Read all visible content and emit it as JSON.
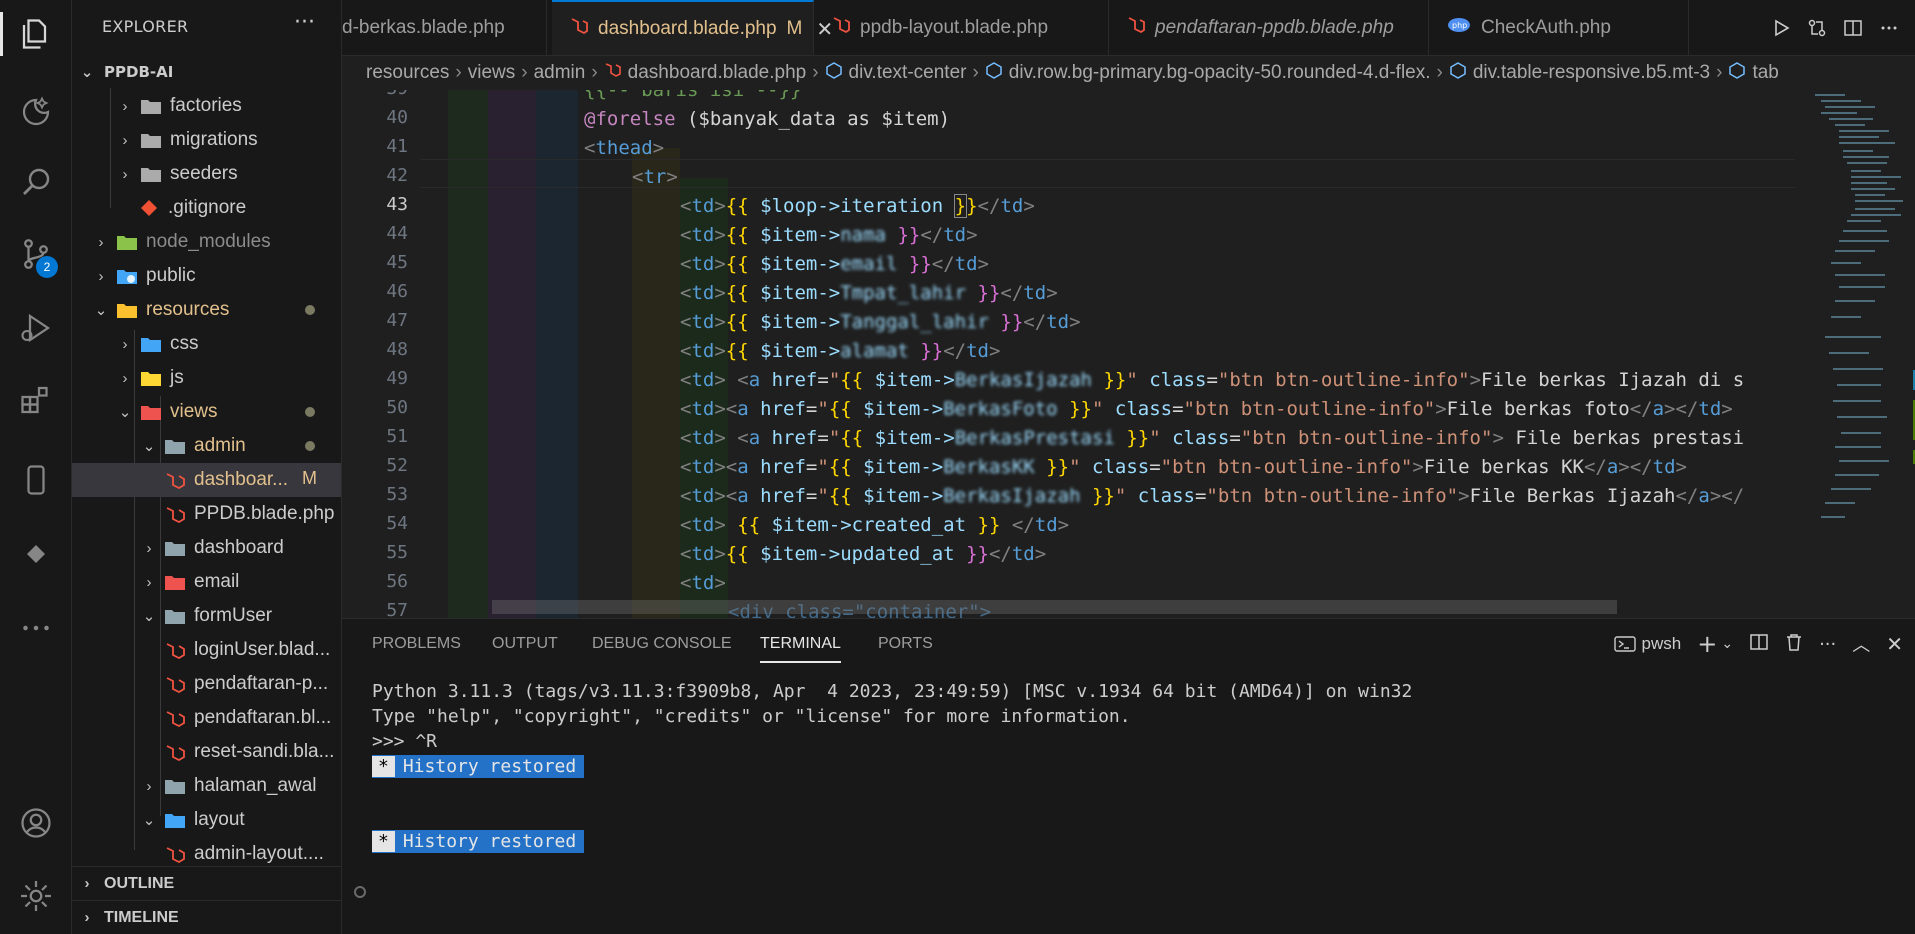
{
  "activity_bar": {
    "source_control_badge": "2"
  },
  "sidebar": {
    "title": "EXPLORER",
    "more": "···",
    "root": "PPDB-AI",
    "items": [
      {
        "label": "factories"
      },
      {
        "label": "migrations"
      },
      {
        "label": "seeders"
      },
      {
        "label": ".gitignore"
      },
      {
        "label": "node_modules"
      },
      {
        "label": "public"
      },
      {
        "label": "resources"
      },
      {
        "label": "css"
      },
      {
        "label": "js"
      },
      {
        "label": "views"
      },
      {
        "label": "admin"
      },
      {
        "label": "dashboar...",
        "status": "M"
      },
      {
        "label": "PPDB.blade.php"
      },
      {
        "label": "dashboard"
      },
      {
        "label": "email"
      },
      {
        "label": "formUser"
      },
      {
        "label": "loginUser.blad..."
      },
      {
        "label": "pendaftaran-p..."
      },
      {
        "label": "pendaftaran.bl..."
      },
      {
        "label": "reset-sandi.bla..."
      },
      {
        "label": "halaman_awal"
      },
      {
        "label": "layout"
      },
      {
        "label": "admin-layout...."
      }
    ],
    "outline": "OUTLINE",
    "timeline": "TIMELINE"
  },
  "tabs": [
    {
      "label": "d-berkas.blade.php"
    },
    {
      "label": "dashboard.blade.php",
      "status": "M",
      "close": "✕"
    },
    {
      "label": "ppdb-layout.blade.php"
    },
    {
      "label": "pendaftaran-ppdb.blade.php"
    },
    {
      "label": "CheckAuth.php"
    }
  ],
  "breadcrumb": [
    "resources",
    "views",
    "admin",
    "dashboard.blade.php",
    "div.text-center",
    "div.row.bg-primary.bg-opacity-50.rounded-4.d-flex.",
    "div.table-responsive.b5.mt-3",
    "tab"
  ],
  "editor": {
    "line_numbers": [
      "39",
      "40",
      "41",
      "42",
      "43",
      "44",
      "45",
      "46",
      "47",
      "48",
      "49",
      "50",
      "51",
      "52",
      "53",
      "54",
      "55",
      "56",
      "57"
    ],
    "current_line": "43",
    "lines": {
      "l39": "{{-- baris isi --}}",
      "l40_kw": "@forelse",
      "l40_rest": " ($banyak_data as $item)",
      "l41": "thead",
      "l42": "tr",
      "l43_var": "$loop->iteration",
      "item": "$item->",
      "blur44": "nama",
      "blur45": "email",
      "blur46": "Tmpat_lahir",
      "blur47": "Tanggal_lahir",
      "blur48": "alamat",
      "blur49": "BerkasIjazah",
      "blur50": "BerkasFoto",
      "blur51": "BerkasPrestasi",
      "blur52": "BerkasKK",
      "blur53": "BerkasIjazah",
      "btn_class": "btn btn-outline-info",
      "txt49": "File berkas Ijazah di s",
      "txt50": "File berkas foto",
      "txt51": " File berkas prestasi",
      "txt52": "File berkas KK",
      "txt53": "File Berkas Ijazah",
      "l54_var": "$item->created_at",
      "l55_var": "$item->updated_at",
      "l57": "<div class=\"container\">"
    }
  },
  "panel": {
    "tabs": [
      "PROBLEMS",
      "OUTPUT",
      "DEBUG CONSOLE",
      "TERMINAL",
      "PORTS"
    ],
    "active_tab": "TERMINAL",
    "shell": "pwsh",
    "terminal": {
      "line1": "Python 3.11.3 (tags/v3.11.3:f3909b8, Apr  4 2023, 23:49:59) [MSC v.1934 64 bit (AMD64)] on win32",
      "line2": "Type \"help\", \"copyright\", \"credits\" or \"license\" for more information.",
      "line3": ">>> ^R",
      "history_star": "*",
      "history_msg": "History restored"
    }
  },
  "colors": {
    "accent": "#0078d4",
    "modified": "#e2c08d",
    "laravel_red": "#f05340",
    "folder": "#c09553"
  }
}
